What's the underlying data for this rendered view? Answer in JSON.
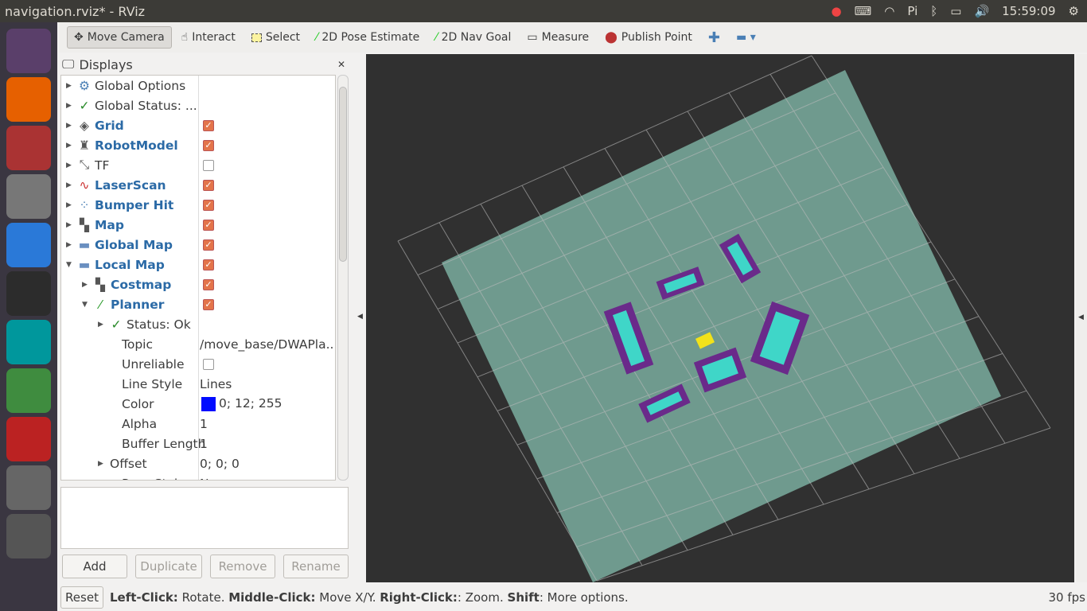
{
  "window": {
    "title": "navigation.rviz* - RViz",
    "clock": "15:59:09"
  },
  "toolbar": {
    "tools": [
      "Move Camera",
      "Interact",
      "Select",
      "2D Pose Estimate",
      "2D Nav Goal",
      "Measure",
      "Publish Point"
    ]
  },
  "displays": {
    "title": "Displays",
    "rows": [
      {
        "label": "Global Options",
        "indent": 0,
        "arrow": "▶",
        "icon": "⚙",
        "icon_color": "#4a7fb5"
      },
      {
        "label": "Global Status: ...",
        "indent": 0,
        "arrow": "▶",
        "icon": "✓",
        "icon_color": "#2a8a2a"
      },
      {
        "label": "Grid",
        "indent": 0,
        "arrow": "▶",
        "icon": "◈",
        "checked": true,
        "blue": true
      },
      {
        "label": "RobotModel",
        "indent": 0,
        "arrow": "▶",
        "icon": "♜",
        "checked": true,
        "blue": true
      },
      {
        "label": "TF",
        "indent": 0,
        "arrow": "▶",
        "icon": "⤡",
        "checked": false
      },
      {
        "label": "LaserScan",
        "indent": 0,
        "arrow": "▶",
        "icon": "∿",
        "icon_color": "#c33",
        "checked": true,
        "blue": true
      },
      {
        "label": "Bumper Hit",
        "indent": 0,
        "arrow": "▶",
        "icon": "⁘",
        "icon_color": "#4a7fb5",
        "checked": true,
        "blue": true
      },
      {
        "label": "Map",
        "indent": 0,
        "arrow": "▶",
        "icon": "▚",
        "checked": true,
        "blue": true
      },
      {
        "label": "Global Map",
        "indent": 0,
        "arrow": "▶",
        "icon": "▬",
        "icon_color": "#6a8fc0",
        "checked": true,
        "blue": true
      },
      {
        "label": "Local Map",
        "indent": 0,
        "arrow": "▼",
        "icon": "▬",
        "icon_color": "#6a8fc0",
        "checked": true,
        "blue": true
      },
      {
        "label": "Costmap",
        "indent": 1,
        "arrow": "▶",
        "icon": "▚",
        "checked": true,
        "blue": true
      },
      {
        "label": "Planner",
        "indent": 1,
        "arrow": "▼",
        "icon": "⁄",
        "icon_color": "#2a9a2a",
        "checked": true,
        "blue": true
      },
      {
        "label": "Status: Ok",
        "indent": 2,
        "arrow": "▶",
        "icon": "✓",
        "icon_color": "#2a8a2a"
      },
      {
        "label": "Topic",
        "indent": 2,
        "value": "/move_base/DWAPla..."
      },
      {
        "label": "Unreliable",
        "indent": 2,
        "checked": false
      },
      {
        "label": "Line Style",
        "indent": 2,
        "value": "Lines"
      },
      {
        "label": "Color",
        "indent": 2,
        "value": "0; 12; 255",
        "swatch": "#000cff"
      },
      {
        "label": "Alpha",
        "indent": 2,
        "value": "1"
      },
      {
        "label": "Buffer Length",
        "indent": 2,
        "value": "1"
      },
      {
        "label": "Offset",
        "indent": 2,
        "arrow": "▶",
        "value": "0; 0; 0"
      },
      {
        "label": "Pose Style",
        "indent": 2,
        "value": "None"
      }
    ]
  },
  "buttons": {
    "add": "Add",
    "duplicate": "Duplicate",
    "remove": "Remove",
    "rename": "Rename",
    "reset": "Reset"
  },
  "status": {
    "hint": [
      [
        "Left-Click:",
        " Rotate. "
      ],
      [
        "Middle-Click:",
        " Move X/Y. "
      ],
      [
        "Right-Click:",
        ": Zoom. "
      ],
      [
        "Shift",
        ": More options."
      ]
    ],
    "fps": "30 fps"
  },
  "launcher": [
    {
      "name": "ubuntu",
      "color": "#5a3f6a"
    },
    {
      "name": "firefox",
      "color": "#e66000"
    },
    {
      "name": "files",
      "color": "#a33"
    },
    {
      "name": "settings",
      "color": "#777"
    },
    {
      "name": "wps",
      "color": "#2a79d8"
    },
    {
      "name": "terminal",
      "color": "#2c2c2c"
    },
    {
      "name": "arduino",
      "color": "#00979c"
    },
    {
      "name": "software-updater",
      "color": "#3f8c3f"
    },
    {
      "name": "app",
      "color": "#b22"
    },
    {
      "name": "rviz",
      "color": "#666"
    },
    {
      "name": "trash",
      "color": "#555"
    }
  ]
}
